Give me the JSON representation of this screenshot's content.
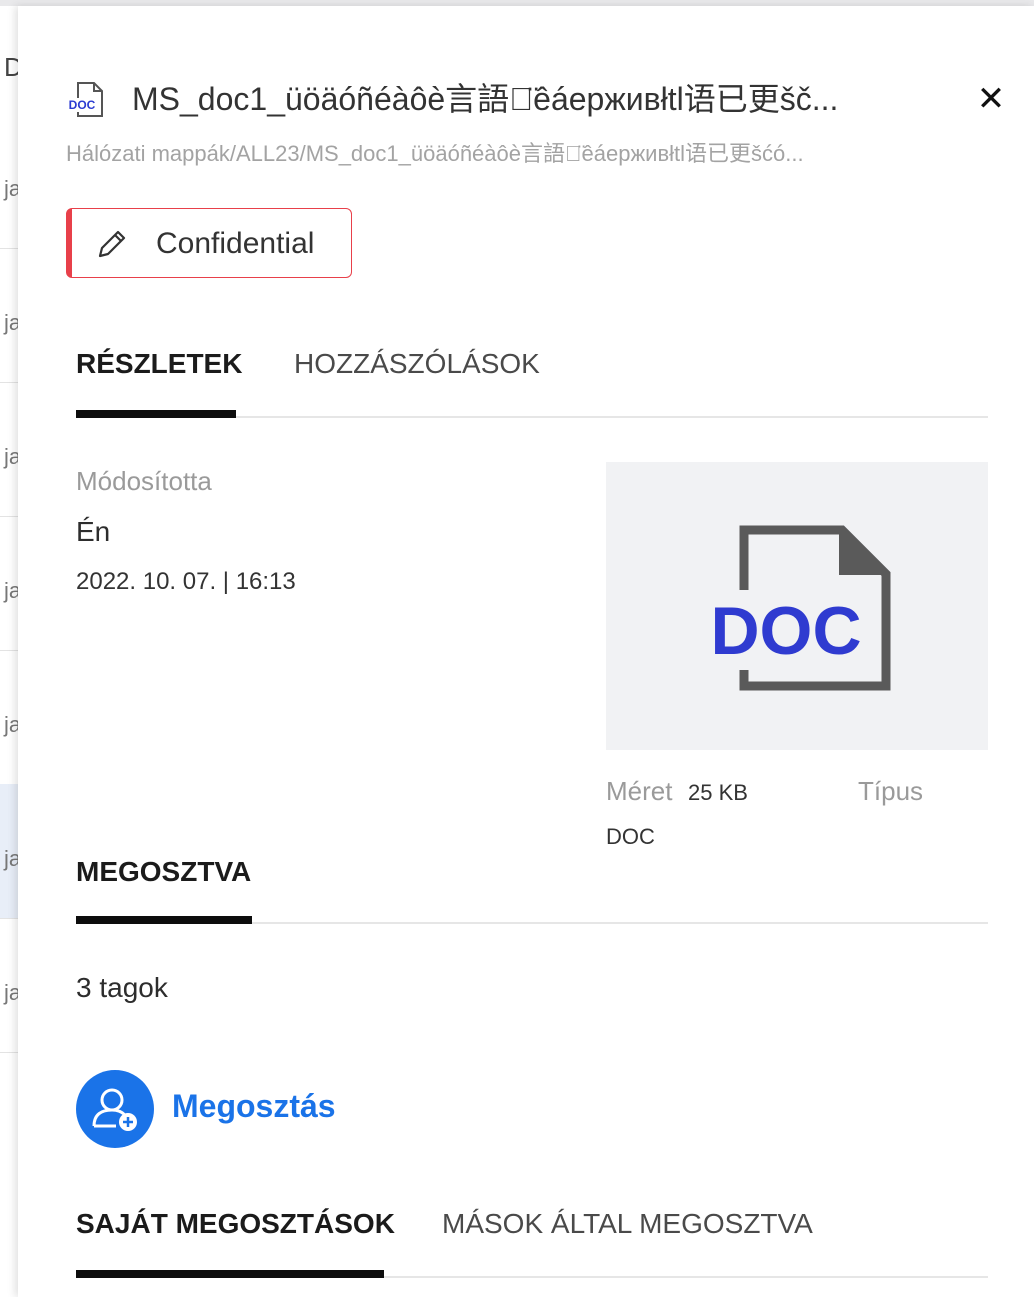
{
  "background": {
    "row_fragment": "ja",
    "top_fragment": "D"
  },
  "file": {
    "icon": "doc-file-icon",
    "name": "MS_doc1_üöäóñéàôè言語が̈êáерживłtl语已更šč...",
    "path": "Hálózati mappák/ALL23/MS_doc1_üöäóñéàôè言語が̈êáерживłtl语已更šćó..."
  },
  "classification": {
    "label": "Confidential",
    "color": "#e8404a"
  },
  "tabs": [
    {
      "label": "RÉSZLETEK",
      "active": true
    },
    {
      "label": "HOZZÁSZÓLÁSOK",
      "active": false
    }
  ],
  "details": {
    "modified_by_label": "Módosította",
    "modified_by_value": "Én",
    "modified_date": "2022. 10. 07. | 16:13",
    "preview_text": "DOC",
    "size_label": "Méret",
    "size_value": "25 KB",
    "type_label": "Típus",
    "type_value": "DOC"
  },
  "shared": {
    "heading": "MEGOSZTVA",
    "members": "3 tagok",
    "share_label": "Megosztás",
    "accent": "#1a73e8"
  },
  "share_tabs": [
    {
      "label": "SAJÁT MEGOSZTÁSOK",
      "active": true
    },
    {
      "label": "MÁSOK ÁLTAL MEGOSZTVA",
      "active": false
    }
  ]
}
